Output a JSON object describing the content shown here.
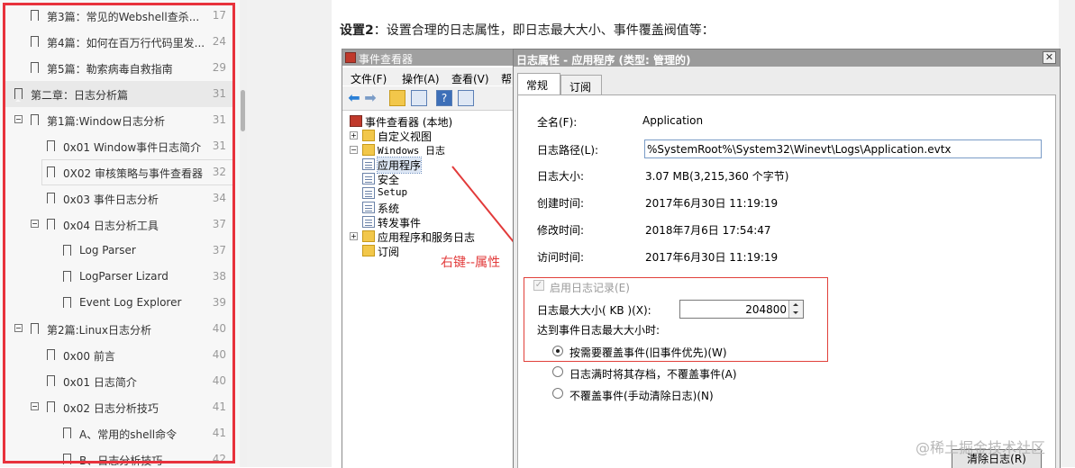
{
  "toc": {
    "items": [
      {
        "label": "第3篇：常见的Webshell查杀...",
        "page": "17"
      },
      {
        "label": "第4篇：如何在百万行代码里发...",
        "page": "24"
      },
      {
        "label": "第5篇：勒索病毒自救指南",
        "page": "29"
      },
      {
        "label": "第二章：日志分析篇",
        "page": "31"
      },
      {
        "label": "第1篇:Window日志分析",
        "page": "31"
      },
      {
        "label": "0x01 Window事件日志简介",
        "page": "31"
      },
      {
        "label": "0X02 审核策略与事件查看器",
        "page": "32"
      },
      {
        "label": "0x03 事件日志分析",
        "page": "34"
      },
      {
        "label": "0x04 日志分析工具",
        "page": "37"
      },
      {
        "label": "Log Parser",
        "page": "37"
      },
      {
        "label": "LogParser Lizard",
        "page": "38"
      },
      {
        "label": "Event Log Explorer",
        "page": "39"
      },
      {
        "label": "第2篇:Linux日志分析",
        "page": "40"
      },
      {
        "label": "0x00 前言",
        "page": "40"
      },
      {
        "label": "0x01 日志简介",
        "page": "40"
      },
      {
        "label": "0x02 日志分析技巧",
        "page": "41"
      },
      {
        "label": "A、常用的shell命令",
        "page": "41"
      },
      {
        "label": "B、日志分析技巧",
        "page": "42"
      }
    ]
  },
  "doc": {
    "heading_bold": "设置2",
    "heading_rest": "：设置合理的日志属性，即日志最大大小、事件覆盖阀值等："
  },
  "event_viewer": {
    "title": "事件查看器",
    "menu": [
      "文件(F)",
      "操作(A)",
      "查看(V)",
      "帮"
    ],
    "tree": {
      "root": "事件查看器 (本地)",
      "custom_views": "自定义视图",
      "windows_logs": "Windows 日志",
      "application": "应用程序",
      "security": "安全",
      "setup": "Setup",
      "system": "系统",
      "forwarded": "转发事件",
      "apps_services": "应用程序和服务日志",
      "subscriptions": "订阅"
    }
  },
  "annotation": "右键--属性",
  "dialog": {
    "title": "日志属性 - 应用程序 (类型: 管理的)",
    "close": "✕",
    "tabs": [
      "常规",
      "订阅"
    ],
    "fields": {
      "full_name_label": "全名(F):",
      "full_name": "Application",
      "path_label": "日志路径(L):",
      "path": "%SystemRoot%\\System32\\Winevt\\Logs\\Application.evtx",
      "size_label": "日志大小:",
      "size": "3.07 MB(3,215,360 个字节)",
      "created_label": "创建时间:",
      "created": "2017年6月30日 11:19:19",
      "modified_label": "修改时间:",
      "modified": "2018年7月6日 17:54:47",
      "accessed_label": "访问时间:",
      "accessed": "2017年6月30日 11:19:19"
    },
    "enable_logging": "启用日志记录(E)",
    "max_size_label": "日志最大大小( KB )(X):",
    "max_size_value": "204800",
    "when_max_label": "达到事件日志最大大小时:",
    "options": [
      "按需要覆盖事件(旧事件优先)(W)",
      "日志满时将其存档，不覆盖事件(A)",
      "不覆盖事件(手动清除日志)(N)"
    ],
    "clear_button": "清除日志(R)"
  },
  "watermark": "@稀土掘金技术社区"
}
